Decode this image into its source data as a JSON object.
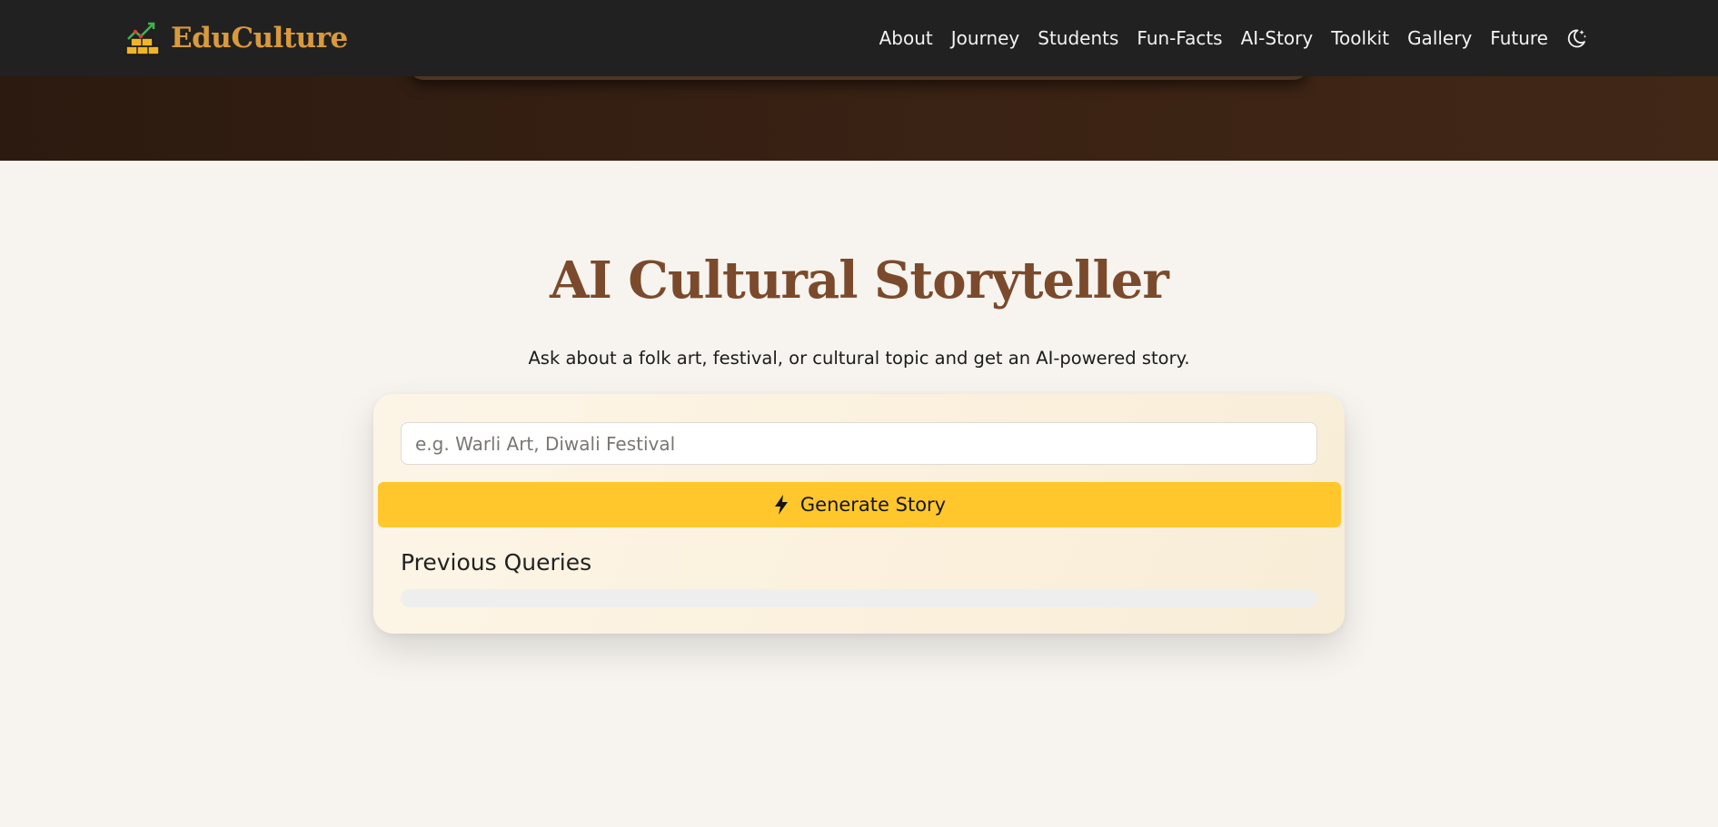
{
  "brand": {
    "name": "EduCulture",
    "icon": "chart-growth-icon",
    "color": "#d99a3c"
  },
  "nav": {
    "items": [
      {
        "label": "About"
      },
      {
        "label": "Journey"
      },
      {
        "label": "Students"
      },
      {
        "label": "Fun-Facts"
      },
      {
        "label": "AI-Story"
      },
      {
        "label": "Toolkit"
      },
      {
        "label": "Gallery"
      },
      {
        "label": "Future"
      }
    ],
    "theme_toggle_icon": "moon-stars-icon"
  },
  "storyteller": {
    "title": "AI Cultural Storyteller",
    "subtitle": "Ask about a folk art, festival, or cultural topic and get an AI-powered story.",
    "input_placeholder": "e.g. Warli Art, Diwali Festival",
    "input_value": "",
    "generate_label": "Generate Story",
    "generate_icon": "bolt-icon",
    "previous_queries_label": "Previous Queries",
    "previous_queries": []
  },
  "colors": {
    "navbar": "#212121",
    "accent_button": "#ffc72c",
    "title": "#7b4a2c",
    "hero_dark": "#3a2214"
  }
}
